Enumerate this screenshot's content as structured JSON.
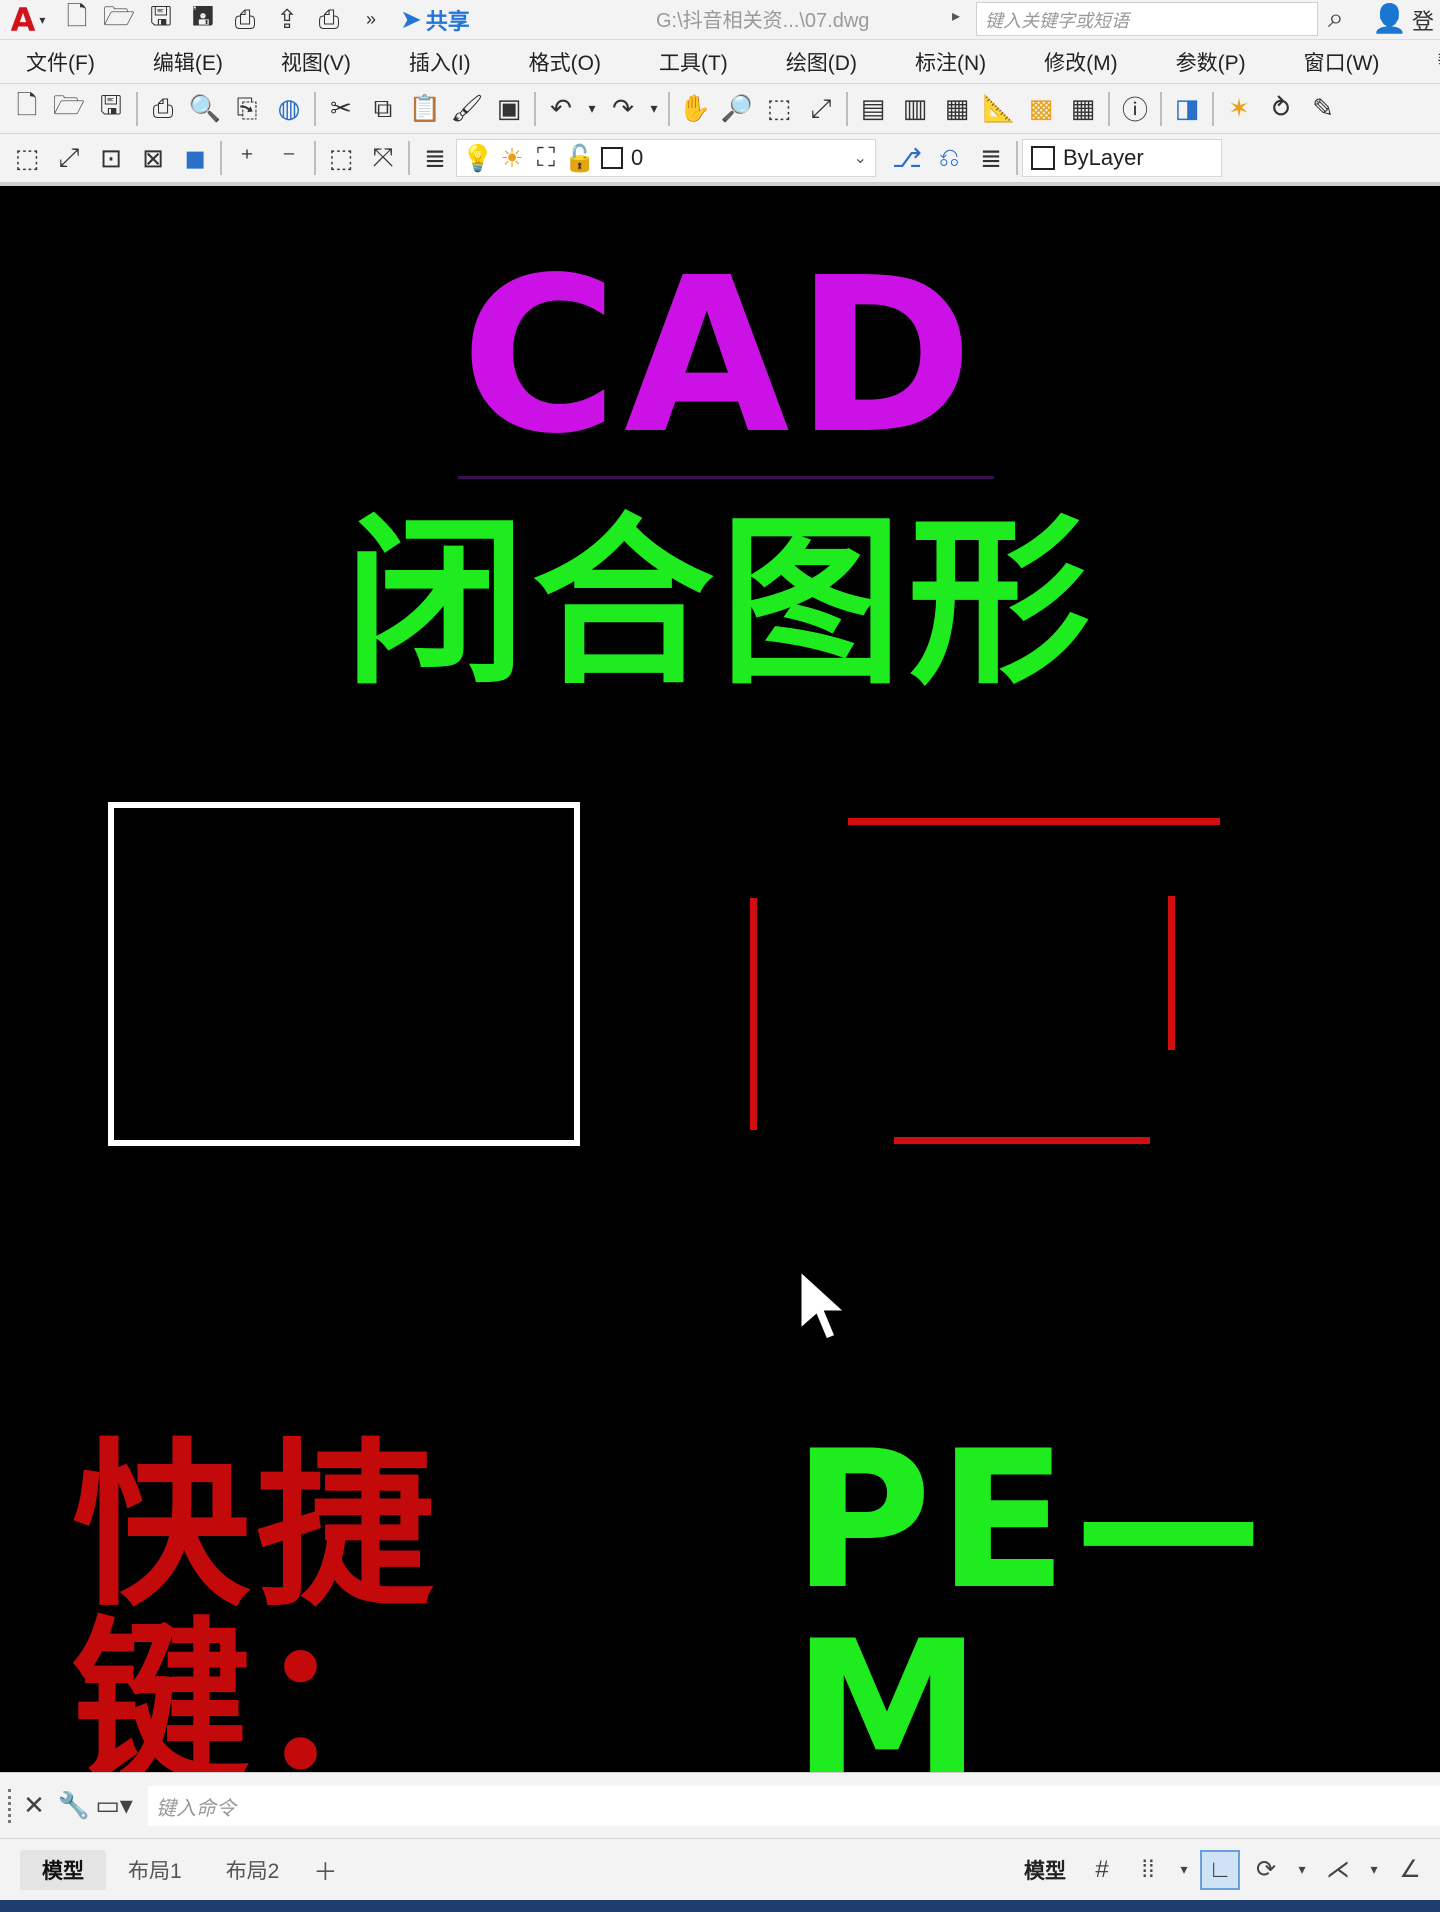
{
  "titlebar": {
    "logo": "A",
    "share_label": "共享",
    "file_path": "G:\\抖音相关资...\\07.dwg",
    "search_placeholder": "键入关键字或短语",
    "login_label": "登"
  },
  "menu": [
    {
      "label": "文件(F)"
    },
    {
      "label": "编辑(E)"
    },
    {
      "label": "视图(V)"
    },
    {
      "label": "插入(I)"
    },
    {
      "label": "格式(O)"
    },
    {
      "label": "工具(T)"
    },
    {
      "label": "绘图(D)"
    },
    {
      "label": "标注(N)"
    },
    {
      "label": "修改(M)"
    },
    {
      "label": "参数(P)"
    },
    {
      "label": "窗口(W)"
    },
    {
      "label": "帮助"
    }
  ],
  "layer_toolbar": {
    "current_layer": "0",
    "color_value": "ByLayer"
  },
  "canvas": {
    "title": "CAD",
    "title_color": "#cc11e6",
    "subtitle": "闭合图形",
    "subtitle_color": "#1fec1f",
    "rect_color": "#ffffff",
    "lines_color": "#d10d10",
    "shortcut_label": "快捷键：",
    "shortcut_label_color": "#c4090b",
    "shortcut_value": "PE—M",
    "shortcut_value_color": "#1fec1f"
  },
  "command_line": {
    "placeholder": "键入命令"
  },
  "status": {
    "tabs": [
      {
        "label": "模型"
      },
      {
        "label": "布局1"
      },
      {
        "label": "布局2"
      }
    ],
    "model_label": "模型"
  }
}
